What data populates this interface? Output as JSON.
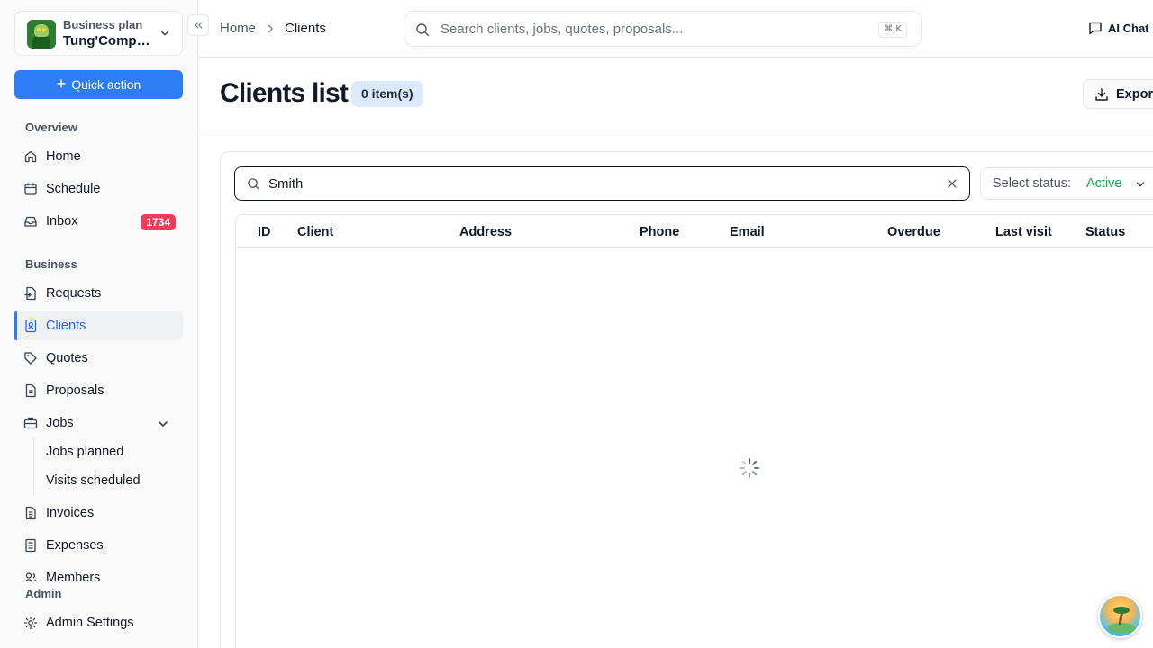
{
  "company": {
    "plan": "Business plan",
    "name": "Tung'Company"
  },
  "quick_action": "Quick action",
  "sidebar": {
    "overview_label": "Overview",
    "overview_items": [
      {
        "label": "Home",
        "icon": "home-icon"
      },
      {
        "label": "Schedule",
        "icon": "calendar-icon"
      },
      {
        "label": "Inbox",
        "icon": "inbox-icon",
        "badge": "1734"
      }
    ],
    "business_label": "Business",
    "business_items": [
      {
        "label": "Requests",
        "icon": "request-icon"
      },
      {
        "label": "Clients",
        "icon": "contact-icon",
        "active": true
      },
      {
        "label": "Quotes",
        "icon": "tag-icon"
      },
      {
        "label": "Proposals",
        "icon": "document-icon"
      },
      {
        "label": "Jobs",
        "icon": "briefcase-icon"
      },
      {
        "label": "Invoices",
        "icon": "invoice-icon"
      },
      {
        "label": "Expenses",
        "icon": "receipt-icon"
      },
      {
        "label": "Members",
        "icon": "users-icon"
      }
    ],
    "jobs_sub": [
      "Jobs planned",
      "Visits scheduled"
    ],
    "admin_label": "Admin",
    "admin_items": [
      {
        "label": "Admin Settings",
        "icon": "gear-icon"
      }
    ]
  },
  "breadcrumb": {
    "home": "Home",
    "current": "Clients"
  },
  "global_search": {
    "placeholder": "Search clients, jobs, quotes, proposals...",
    "shortcut": "⌘ K"
  },
  "ai_chat": "AI Chat",
  "page": {
    "title": "Clients list",
    "count": "0 item(s)",
    "export": "Export"
  },
  "filters": {
    "search_value": "Smith",
    "status_label": "Select status:",
    "status_value": "Active"
  },
  "table": {
    "columns": [
      "ID",
      "Client",
      "Address",
      "Phone",
      "Email",
      "Overdue",
      "Last visit",
      "Status"
    ]
  },
  "colors": {
    "accent": "#2f7df6",
    "badge": "#ef3e5c",
    "status_active": "#16a34a",
    "count_pill": "#dbeafe"
  }
}
